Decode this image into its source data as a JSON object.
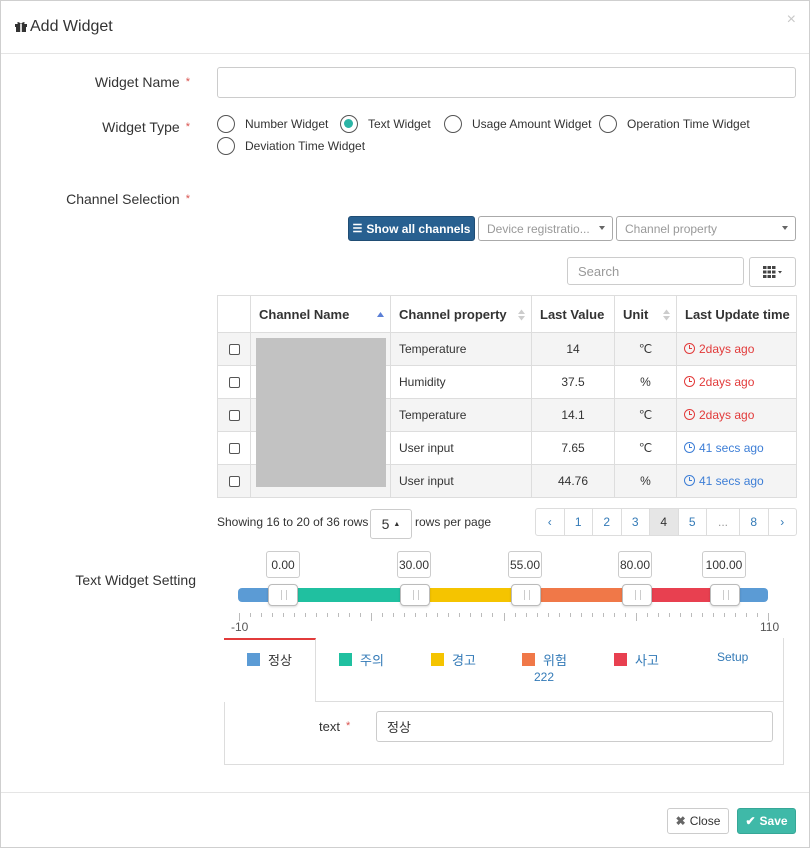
{
  "dialog": {
    "title": "Add Widget"
  },
  "form": {
    "widget_name_label": "Widget Name",
    "widget_type_label": "Widget Type",
    "channel_selection_label": "Channel Selection",
    "text_widget_setting_label": "Text Widget Setting",
    "required_mark": "*",
    "widget_name_value": ""
  },
  "widget_types": [
    {
      "label": "Number Widget",
      "selected": false
    },
    {
      "label": "Text Widget",
      "selected": true
    },
    {
      "label": "Usage Amount Widget",
      "selected": false
    },
    {
      "label": "Operation Time Widget",
      "selected": false
    },
    {
      "label": "Deviation Time Widget",
      "selected": false
    }
  ],
  "toolbar": {
    "show_all_label": "Show all channels",
    "device_select_value": "Device registratio...",
    "property_select_value": "Channel property",
    "search_placeholder": "Search",
    "columns_icon": "grid-icon"
  },
  "table": {
    "headers": [
      "Channel Name",
      "Channel property",
      "Last Value",
      "Unit",
      "Last Update time"
    ],
    "rows": [
      {
        "property": "Temperature",
        "value": "14",
        "unit": "℃",
        "updated": "2days ago",
        "status": "stale"
      },
      {
        "property": "Humidity",
        "value": "37.5",
        "unit": "%",
        "updated": "2days ago",
        "status": "stale"
      },
      {
        "property": "Temperature",
        "value": "14.1",
        "unit": "℃",
        "updated": "2days ago",
        "status": "stale"
      },
      {
        "property": "User input",
        "value": "7.65",
        "unit": "℃",
        "updated": "41 secs ago",
        "status": "recent"
      },
      {
        "property": "User input",
        "value": "44.76",
        "unit": "%",
        "updated": "41 secs ago",
        "status": "recent"
      }
    ]
  },
  "pager": {
    "info": "Showing 16 to 20 of 36 rows",
    "page_size": "5",
    "rows_per_page": "rows per page",
    "prev": "‹",
    "pages": [
      "1",
      "2",
      "3",
      "4",
      "5",
      "...",
      "8"
    ],
    "current_page": "4",
    "next": "›"
  },
  "slider": {
    "min": "-10",
    "max": "110",
    "thresholds": [
      "0.00",
      "30.00",
      "55.00",
      "80.00",
      "100.00"
    ],
    "colors": {
      "normal": "#5b9bd5",
      "caution": "#20c0a0",
      "warning": "#f5c400",
      "danger": "#f07848",
      "accident": "#e84050"
    }
  },
  "levels": [
    {
      "label": "정상",
      "color": "#5b9bd5"
    },
    {
      "label": "주의",
      "color": "#20c0a0"
    },
    {
      "label": "경고",
      "color": "#f5c400"
    },
    {
      "label": "위험",
      "color": "#f07848",
      "sub": "222"
    },
    {
      "label": "사고",
      "color": "#e84050"
    }
  ],
  "setup_label": "Setup",
  "text_field": {
    "label": "text",
    "value": "정상"
  },
  "footer": {
    "close_label": "Close",
    "save_label": "Save"
  }
}
